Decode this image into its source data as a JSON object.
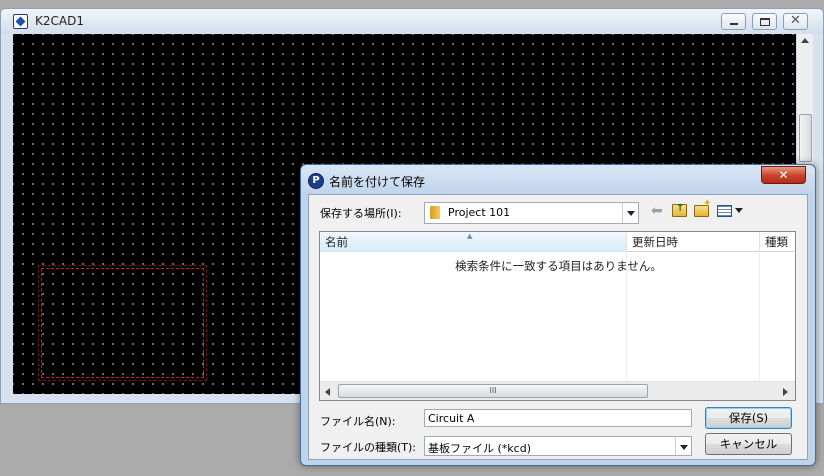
{
  "cad_window": {
    "title": "K2CAD1"
  },
  "dialog": {
    "title": "名前を付けて保存",
    "close_label": "✕",
    "location": {
      "label": "保存する場所(I):",
      "value": "Project 101"
    },
    "toolbar": {
      "icons": [
        "back-arrow-icon",
        "up-folder-icon",
        "new-folder-icon",
        "views-menu-icon"
      ]
    },
    "file_list": {
      "columns": [
        "名前",
        "更新日時",
        "種類"
      ],
      "empty_message": "検索条件に一致する項目はありません。",
      "hscroll_grip": "III"
    },
    "filename": {
      "label": "ファイル名(N):",
      "value": "Circuit A"
    },
    "filetype": {
      "label": "ファイルの種類(T):",
      "value": "基板ファイル (*kcd)"
    },
    "buttons": {
      "save": "保存(S)",
      "cancel": "キャンセル"
    }
  },
  "colors": {
    "canvas_background": "#000000",
    "grid_dot": "#7a7a7a",
    "selection": "#c8211f",
    "dialog_frame": "#bfd3ea",
    "close_button": "#c9412a"
  }
}
